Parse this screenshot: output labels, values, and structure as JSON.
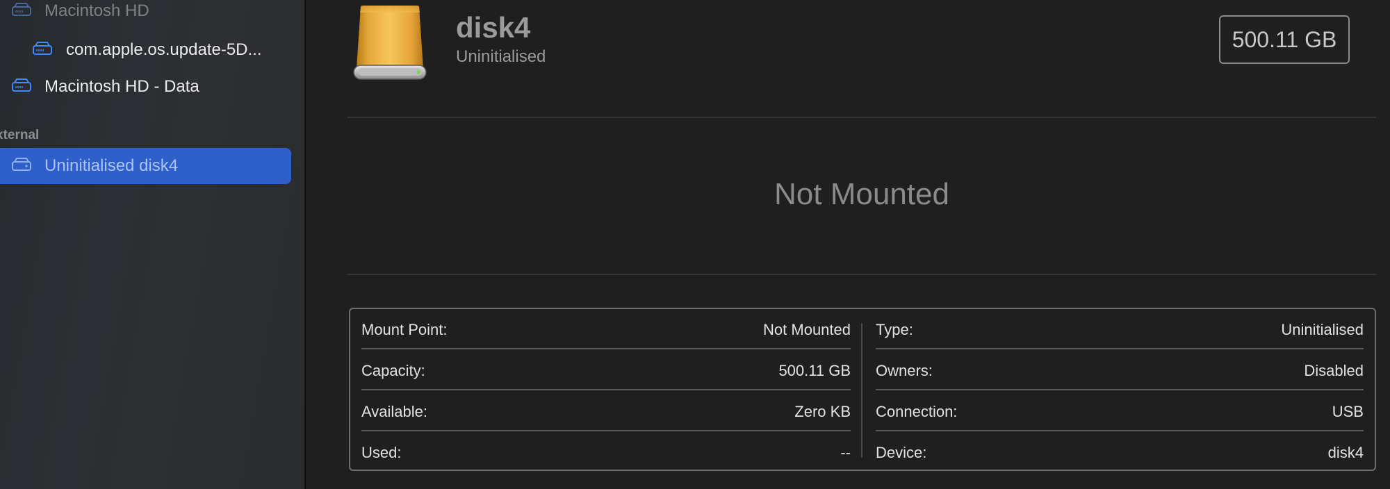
{
  "sidebar": {
    "items": [
      {
        "label": "Macintosh HD",
        "state": "dim"
      },
      {
        "label": "com.apple.os.update-5D..."
      },
      {
        "label": "Macintosh HD - Data"
      }
    ],
    "section_label": "xternal",
    "selected_item": {
      "label": "Uninitialised disk4"
    }
  },
  "disk": {
    "name": "disk4",
    "subtitle": "Uninitialised",
    "size": "500.11 GB",
    "status": "Not Mounted"
  },
  "info": {
    "left": [
      {
        "key": "Mount Point:",
        "value": "Not Mounted"
      },
      {
        "key": "Capacity:",
        "value": "500.11 GB"
      },
      {
        "key": "Available:",
        "value": "Zero KB"
      },
      {
        "key": "Used:",
        "value": "--"
      }
    ],
    "right": [
      {
        "key": "Type:",
        "value": "Uninitialised"
      },
      {
        "key": "Owners:",
        "value": "Disabled"
      },
      {
        "key": "Connection:",
        "value": "USB"
      },
      {
        "key": "Device:",
        "value": "disk4"
      }
    ]
  },
  "colors": {
    "selection": "#2f5fc9",
    "disk_accent": "#f0b84a",
    "icon_blue": "#3d8bff"
  }
}
